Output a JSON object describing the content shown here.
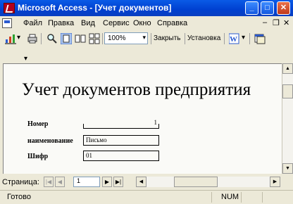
{
  "window": {
    "title": "Microsoft Access - [Учет документов]"
  },
  "menubar": {
    "items": [
      {
        "label": "Файл"
      },
      {
        "label": "Правка"
      },
      {
        "label": "Вид"
      },
      {
        "label": "Сервис"
      },
      {
        "label": "Окно"
      },
      {
        "label": "Справка"
      }
    ]
  },
  "toolbar": {
    "zoom": "100%",
    "close_label": "Закрыть",
    "setup_label": "Установка",
    "overflow": "▾"
  },
  "report": {
    "title": "Учет документов предприятия",
    "fields": [
      {
        "label": "Номер",
        "value": "1"
      },
      {
        "label": "наименование",
        "value": "Письмо"
      },
      {
        "label": "Шифр",
        "value": "01"
      }
    ]
  },
  "navigation": {
    "page_label": "Страница:",
    "page_value": "1"
  },
  "statusbar": {
    "status": "Готово",
    "num": "NUM"
  },
  "colors": {
    "titlebar": "#0a5be6",
    "close_button": "#c0391a",
    "page_background": "#fafaf7"
  }
}
